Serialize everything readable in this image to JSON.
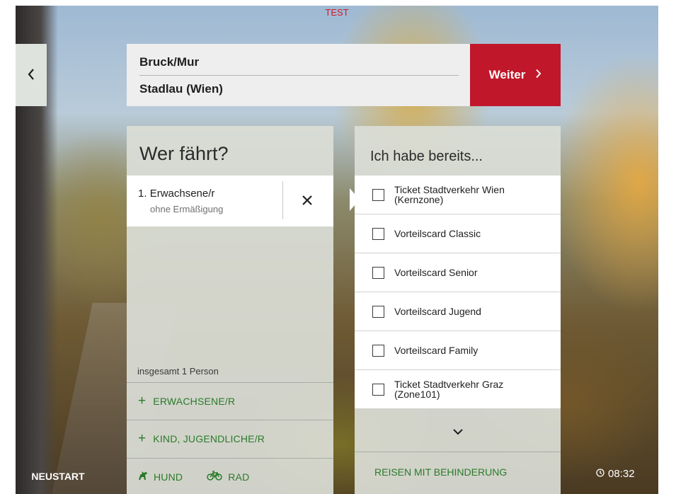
{
  "banner": {
    "test_label": "TEST"
  },
  "route": {
    "from": "Bruck/Mur",
    "to": "Stadlau (Wien)"
  },
  "buttons": {
    "next_label": "Weiter",
    "restart_label": "NEUSTART"
  },
  "travelers": {
    "title": "Wer fährt?",
    "items": [
      {
        "number": "1.",
        "type": "Erwachsene/r",
        "discount": "ohne Ermäßigung"
      }
    ],
    "total": "insgesamt 1 Person",
    "add_adult": "ERWACHSENE/R",
    "add_child": "KIND, JUGENDLICHE/R",
    "dog": "HUND",
    "bike": "RAD"
  },
  "cards": {
    "title": "Ich habe bereits...",
    "items": [
      {
        "label": "Ticket Stadtverkehr Wien (Kernzone)",
        "checked": false
      },
      {
        "label": "Vorteilscard Classic",
        "checked": false
      },
      {
        "label": "Vorteilscard Senior",
        "checked": false
      },
      {
        "label": "Vorteilscard Jugend",
        "checked": false
      },
      {
        "label": "Vorteilscard Family",
        "checked": false
      },
      {
        "label": "Ticket Stadtverkehr Graz (Zone101)",
        "checked": false
      }
    ],
    "disability_link": "REISEN MIT BEHINDERUNG"
  },
  "status": {
    "time": "08:32"
  },
  "colors": {
    "accent_red": "#c0172a",
    "link_green": "#2a7a2a",
    "panel_bg": "#daded6"
  }
}
